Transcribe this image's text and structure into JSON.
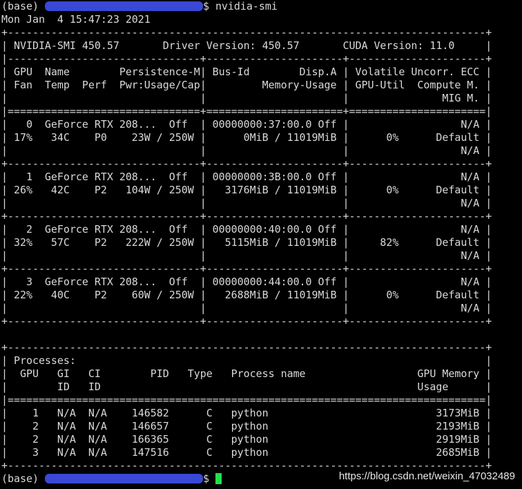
{
  "prompt": {
    "env": "(base)",
    "suffix": "$ ",
    "command": "nvidia-smi",
    "suffix_final": "$ "
  },
  "timestamp": "Mon Jan  4 15:47:23 2021",
  "lines": [
    "+-----------------------------------------------------------------------------+",
    "| NVIDIA-SMI 450.57       Driver Version: 450.57       CUDA Version: 11.0     |",
    "|-------------------------------+----------------------+----------------------+",
    "| GPU  Name        Persistence-M| Bus-Id        Disp.A | Volatile Uncorr. ECC |",
    "| Fan  Temp  Perf  Pwr:Usage/Cap|         Memory-Usage | GPU-Util  Compute M. |",
    "|                               |                      |               MIG M. |",
    "|===============================+======================+======================|",
    "|   0  GeForce RTX 208...  Off  | 00000000:37:00.0 Off |                  N/A |",
    "| 17%   34C    P0    23W / 250W |      0MiB / 11019MiB |      0%      Default |",
    "|                               |                      |                  N/A |",
    "+-------------------------------+----------------------+----------------------+",
    "|   1  GeForce RTX 208...  Off  | 00000000:3B:00.0 Off |                  N/A |",
    "| 26%   42C    P2   104W / 250W |   3176MiB / 11019MiB |      0%      Default |",
    "|                               |                      |                  N/A |",
    "+-------------------------------+----------------------+----------------------+",
    "|   2  GeForce RTX 208...  Off  | 00000000:40:00.0 Off |                  N/A |",
    "| 32%   57C    P2   222W / 250W |   5115MiB / 11019MiB |     82%      Default |",
    "|                               |                      |                  N/A |",
    "+-------------------------------+----------------------+----------------------+",
    "|   3  GeForce RTX 208...  Off  | 00000000:44:00.0 Off |                  N/A |",
    "| 22%   40C    P2    60W / 250W |   2688MiB / 11019MiB |      0%      Default |",
    "|                               |                      |                  N/A |",
    "+-------------------------------+----------------------+----------------------+",
    "",
    "+-----------------------------------------------------------------------------+",
    "| Processes:                                                                  |",
    "|  GPU   GI   CI        PID   Type   Process name                  GPU Memory |",
    "|        ID   ID                                                   Usage      |",
    "|=============================================================================|",
    "|    1   N/A  N/A    146582      C   python                           3173MiB |",
    "|    2   N/A  N/A    146657      C   python                           2193MiB |",
    "|    2   N/A  N/A    166365      C   python                           2919MiB |",
    "|    3   N/A  N/A    147516      C   python                           2685MiB |",
    "+-----------------------------------------------------------------------------+"
  ],
  "watermark": "https://blog.csdn.net/weixin_47032489",
  "colors": {
    "background": "#000000",
    "text": "#d9d9d9",
    "redaction": "#3a48d6",
    "cursor": "#22e04a"
  }
}
